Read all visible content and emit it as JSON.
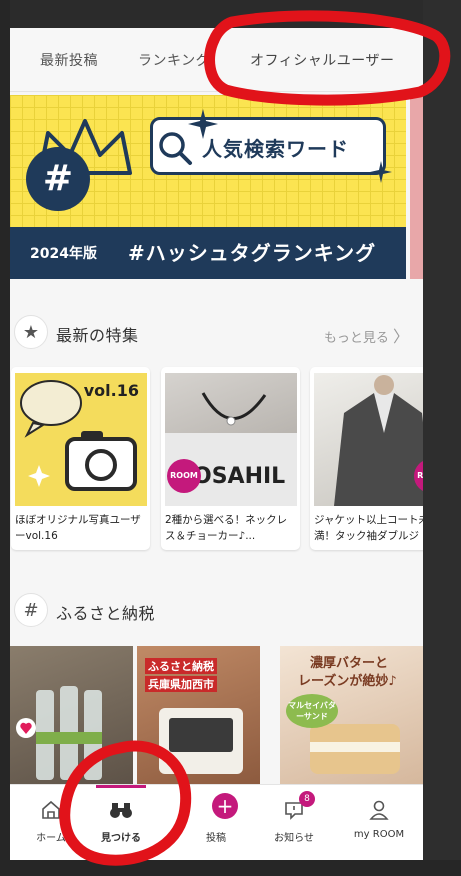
{
  "tabs": [
    {
      "label": "最新投稿"
    },
    {
      "label": "ランキング"
    },
    {
      "label": "オフィシャルユーザー"
    }
  ],
  "banner": {
    "title": "人気検索ワード",
    "year": "2024年版",
    "subtitle": "#ハッシュタグランキング",
    "icon_glyph": "#"
  },
  "feature_section": {
    "icon": "star-icon",
    "title": "最新の特集",
    "more": "もっと見る"
  },
  "feature_cards": [
    {
      "text": "ほぼオリジナル写真ユーザーvol.16",
      "badge": "vol.16",
      "icon": "camera-icon"
    },
    {
      "text": "2種から選べる！ネックレス＆チョーカー♪...",
      "badge": "ROOM Style"
    },
    {
      "text": "ジャケット以上コート未満！タック袖ダブルジ",
      "badge": "ROOM Style"
    }
  ],
  "furusato_section": {
    "icon": "hash-icon",
    "title": "ふるさと納税"
  },
  "furusato_labels": {
    "img2_line1": "ふるさと納税",
    "img2_line2": "兵庫県加西市",
    "img3_line1": "濃厚バターと",
    "img3_line2": "レーズンが絶妙♪",
    "img3_badge": "マルセイバターサンド"
  },
  "nav": [
    {
      "label": "ホーム",
      "icon": "home-icon"
    },
    {
      "label": "見つける",
      "icon": "binoculars-icon"
    },
    {
      "label": "投稿",
      "icon": "plus-icon"
    },
    {
      "label": "お知らせ",
      "icon": "bell-icon",
      "count": "8"
    },
    {
      "label": "my ROOM",
      "icon": "person-icon"
    }
  ],
  "colors": {
    "accent": "#c4197c",
    "annotation": "#e1131a",
    "banner_yellow": "#fbe451",
    "banner_navy": "#1f3a5a"
  }
}
